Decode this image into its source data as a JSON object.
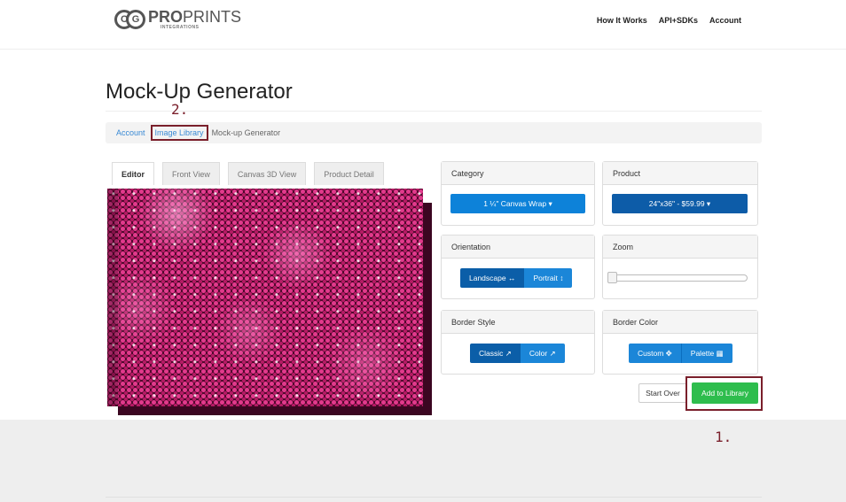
{
  "header": {
    "logo_mark": "CG",
    "logo_main_bold": "PRO",
    "logo_main": "PRINTS",
    "logo_sub": "INTEGRATIONS",
    "nav": [
      "How It Works",
      "API+SDKs",
      "Account"
    ]
  },
  "page": {
    "title": "Mock-Up Generator"
  },
  "breadcrumb": [
    "Account",
    "Image Library",
    "Mock-up Generator"
  ],
  "annotations": {
    "step1": "1.",
    "step2": "2.",
    "highlight_color": "#7a1f2b"
  },
  "tabs": [
    "Editor",
    "Front View",
    "Canvas 3D View",
    "Product Detail"
  ],
  "panels": {
    "category": {
      "title": "Category",
      "value": "1 ¼\" Canvas Wrap"
    },
    "product": {
      "title": "Product",
      "value": "24\"x36\" - $59.99"
    },
    "orientation": {
      "title": "Orientation",
      "options": [
        "Landscape ↔",
        "Portrait ↕"
      ]
    },
    "zoom": {
      "title": "Zoom",
      "level": 0
    },
    "border_style": {
      "title": "Border Style",
      "options": [
        "Classic ↗",
        "Color ↗"
      ]
    },
    "border_color": {
      "title": "Border Color",
      "options": [
        "Custom ✥",
        "Palette ▦"
      ]
    }
  },
  "actions": {
    "start_over": "Start Over",
    "add_to_library": "Add to Library"
  },
  "colors": {
    "primary": "#0d82d9",
    "primary_dark": "#0d5ca8",
    "success": "#2ebd4d"
  }
}
